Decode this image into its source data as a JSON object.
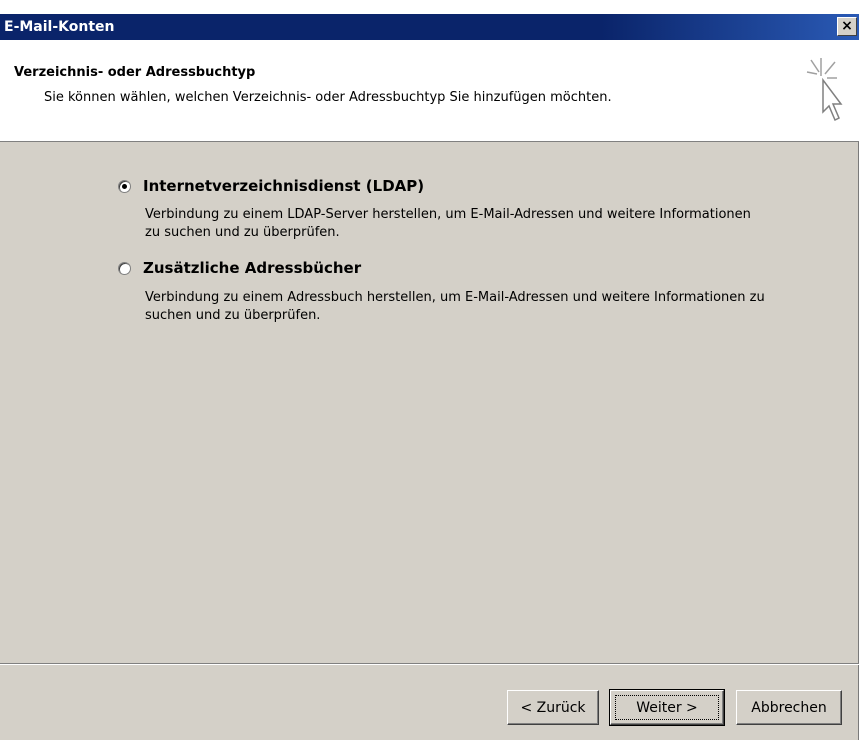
{
  "window": {
    "title": "E-Mail-Konten",
    "close_label": "×"
  },
  "header": {
    "title": "Verzeichnis- oder Adressbuchtyp",
    "subtitle": "Sie können wählen, welchen Verzeichnis- oder Adressbuchtyp Sie hinzufügen möchten.",
    "icon": "wizard-cursor-icon"
  },
  "options": [
    {
      "label": "Internetverzeichnisdienst (LDAP)",
      "checked": true,
      "description": "Verbindung zu einem LDAP-Server herstellen, um E-Mail-Adressen und weitere Informationen zu suchen und zu überprüfen."
    },
    {
      "label": "Zusätzliche Adressbücher",
      "checked": false,
      "description": "Verbindung zu einem Adressbuch herstellen, um E-Mail-Adressen und weitere Informationen zu suchen und zu überprüfen."
    }
  ],
  "buttons": {
    "back_label": "< Zurück",
    "next_label": "Weiter >",
    "cancel_label": "Abbrechen"
  },
  "colors": {
    "titlebar": "#0a246a",
    "dialog_bg": "#d4d0c8"
  }
}
